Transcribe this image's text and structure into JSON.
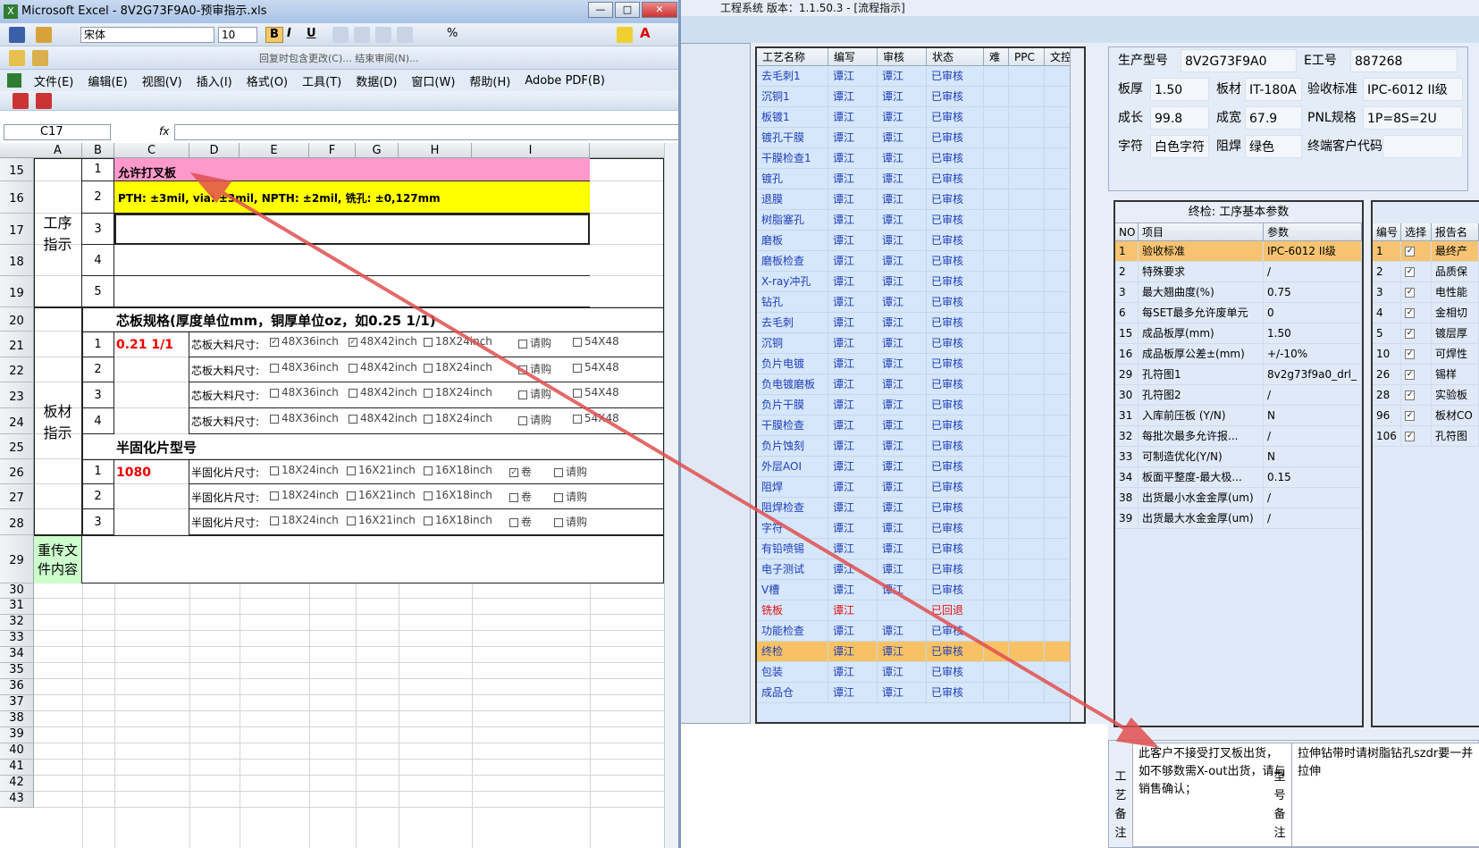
{
  "app": {
    "title": "工程系统  版本：1.1.50.3 - [流程指示]",
    "process_table": {
      "headers": [
        "工艺名称",
        "编写",
        "审核",
        "状态",
        "难",
        "PPC",
        "文控"
      ],
      "rows": [
        [
          "去毛刺1",
          "谭江",
          "谭江",
          "已审核"
        ],
        [
          "沉铜1",
          "谭江",
          "谭江",
          "已审核"
        ],
        [
          "板镀1",
          "谭江",
          "谭江",
          "已审核"
        ],
        [
          "镀孔干膜",
          "谭江",
          "谭江",
          "已审核"
        ],
        [
          "干膜检查1",
          "谭江",
          "谭江",
          "已审核"
        ],
        [
          "镀孔",
          "谭江",
          "谭江",
          "已审核"
        ],
        [
          "退膜",
          "谭江",
          "谭江",
          "已审核"
        ],
        [
          "树脂塞孔",
          "谭江",
          "谭江",
          "已审核"
        ],
        [
          "磨板",
          "谭江",
          "谭江",
          "已审核"
        ],
        [
          "磨板检查",
          "谭江",
          "谭江",
          "已审核"
        ],
        [
          "X-ray冲孔",
          "谭江",
          "谭江",
          "已审核"
        ],
        [
          "钻孔",
          "谭江",
          "谭江",
          "已审核"
        ],
        [
          "去毛刺",
          "谭江",
          "谭江",
          "已审核"
        ],
        [
          "沉铜",
          "谭江",
          "谭江",
          "已审核"
        ],
        [
          "负片电镀",
          "谭江",
          "谭江",
          "已审核"
        ],
        [
          "负电镀磨板",
          "谭江",
          "谭江",
          "已审核"
        ],
        [
          "负片干膜",
          "谭江",
          "谭江",
          "已审核"
        ],
        [
          "干膜检查",
          "谭江",
          "谭江",
          "已审核"
        ],
        [
          "负片蚀刻",
          "谭江",
          "谭江",
          "已审核"
        ],
        [
          "外层AOI",
          "谭江",
          "谭江",
          "已审核"
        ],
        [
          "阻焊",
          "谭江",
          "谭江",
          "已审核"
        ],
        [
          "阻焊检查",
          "谭江",
          "谭江",
          "已审核"
        ],
        [
          "字符",
          "谭江",
          "谭江",
          "已审核"
        ],
        [
          "有铅喷锡",
          "谭江",
          "谭江",
          "已审核"
        ],
        [
          "电子测试",
          "谭江",
          "谭江",
          "已审核"
        ],
        [
          "V槽",
          "谭江",
          "谭江",
          "已审核"
        ],
        [
          "铣板",
          "谭江",
          "",
          "已回退"
        ],
        [
          "功能检查",
          "谭江",
          "谭江",
          "已审核"
        ],
        [
          "终检",
          "谭江",
          "谭江",
          "已审核"
        ],
        [
          "包装",
          "谭江",
          "谭江",
          "已审核"
        ],
        [
          "成品仓",
          "谭江",
          "谭江",
          "已审核"
        ]
      ]
    },
    "info": {
      "model_label": "生产型号",
      "model": "8V2G73F9A0",
      "eno_label": "E工号",
      "eno": "887268",
      "thick_label": "板厚",
      "thick": "1.50",
      "material_label": "板材",
      "material": "IT-180A",
      "std_label": "验收标准",
      "std": "IPC-6012 II级",
      "len_label": "成长",
      "len": "99.8",
      "width_label": "成宽",
      "width": "67.9",
      "pnl_label": "PNL规格",
      "pnl": "1P=8S=2U",
      "char_label": "字符",
      "char": "白色字符",
      "mask_label": "阻焊",
      "mask": "绿色",
      "cust_label": "终端客户代码",
      "cust": ""
    },
    "params": {
      "title": "终检: 工序基本参数",
      "headers": [
        "NO",
        "项目",
        "参数"
      ],
      "rows": [
        [
          "1",
          "验收标准",
          "IPC-6012 II级"
        ],
        [
          "2",
          "特殊要求",
          "/"
        ],
        [
          "3",
          "最大翘曲度(%)",
          "0.75"
        ],
        [
          "6",
          "每SET最多允许废单元",
          "0"
        ],
        [
          "15",
          "成品板厚(mm)",
          "1.50"
        ],
        [
          "16",
          "成品板厚公差±(mm)",
          "+/-10%"
        ],
        [
          "29",
          "孔符图1",
          "8v2g73f9a0_drl_"
        ],
        [
          "30",
          "孔符图2",
          "/"
        ],
        [
          "31",
          "入库前压板 (Y/N)",
          "N"
        ],
        [
          "32",
          "每批次最多允许报...",
          "/"
        ],
        [
          "33",
          "可制造优化(Y/N)",
          "N"
        ],
        [
          "34",
          "板面平整度-最大极...",
          "0.15"
        ],
        [
          "38",
          "出货最小水金金厚(um)",
          "/"
        ],
        [
          "39",
          "出货最大水金金厚(um)",
          "/"
        ]
      ]
    },
    "report": {
      "headers": [
        "编号",
        "选择",
        "报告名"
      ],
      "rows": [
        [
          "1",
          "最终产"
        ],
        [
          "2",
          "品质保"
        ],
        [
          "3",
          "电性能"
        ],
        [
          "4",
          "金相切"
        ],
        [
          "5",
          "镀层厚"
        ],
        [
          "10",
          "可焊性"
        ],
        [
          "26",
          "锡样"
        ],
        [
          "28",
          "实验板"
        ],
        [
          "96",
          "板材CO"
        ],
        [
          "106",
          "孔符图"
        ]
      ]
    },
    "notes": {
      "craft_label": "工艺备注",
      "craft_text": "此客户不接受打叉板出货，如不够数需X-out出货，请与销售确认；",
      "model_label": "型号备注",
      "model_text": "拉伸钻带时请树脂钻孔szdr要一并拉伸"
    }
  },
  "excel": {
    "title": "Microsoft Excel - 8V2G73F9A0-预审指示.xls",
    "font_name": "宋体",
    "font_size": "10",
    "toolbar2_text": "回复时包含更改(C)... 结束审阅(N)...",
    "menus": [
      "文件(E)",
      "编辑(E)",
      "视图(V)",
      "插入(I)",
      "格式(O)",
      "工具(T)",
      "数据(D)",
      "窗口(W)",
      "帮助(H)",
      "Adobe PDF(B)"
    ],
    "name_box": "C17",
    "fx": "fx",
    "columns": [
      "A",
      "B",
      "C",
      "D",
      "E",
      "F",
      "G",
      "H",
      "I"
    ],
    "rows": [
      "15",
      "16",
      "17",
      "18",
      "19",
      "20",
      "21",
      "22",
      "23",
      "24",
      "25",
      "26",
      "27",
      "28",
      "29",
      "30",
      "31",
      "32",
      "33",
      "34",
      "35",
      "36",
      "37",
      "38",
      "39",
      "40",
      "41",
      "42",
      "43"
    ],
    "section1": "工序指示",
    "section2": "板材指示",
    "section3": "重传文件内容",
    "r15_text": "允许打叉板",
    "r16_text": "PTH: ±3mil,  via: ±3mil,  NPTH: ±2mil,  铣孔: ±0,127mm",
    "core_spec": "芯板规格(厚度单位mm，铜厚单位oz，如0.25 1/1)",
    "core_val": "0.21  1/1",
    "core_label": "芯板大料尺寸:",
    "opt1": "48X36inch",
    "opt2": "48X42inch",
    "opt3": "18X24inch",
    "opt4": "请购",
    "opt5": "54X48",
    "pp_title": "半固化片型号",
    "pp_val": "1080",
    "pp_label": "半固化片尺寸:",
    "pp1": "18X24inch",
    "pp2": "16X21inch",
    "pp3": "16X18inch",
    "pp4": "卷",
    "pp5": "请购",
    "n1": "1",
    "n2": "2",
    "n3": "3",
    "n4": "4",
    "n5": "5"
  }
}
